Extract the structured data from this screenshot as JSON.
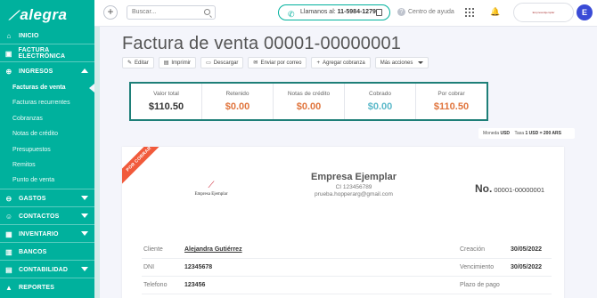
{
  "app": {
    "logo_text": "alegra"
  },
  "sidebar": {
    "items": [
      {
        "label": "INICIO",
        "icon": "home-icon"
      },
      {
        "label": "FACTURA ELECTRÓNICA",
        "icon": "invoice-icon"
      },
      {
        "label": "INGRESOS",
        "icon": "income-icon"
      },
      {
        "label": "GASTOS",
        "icon": "expenses-icon"
      },
      {
        "label": "CONTACTOS",
        "icon": "contacts-icon"
      },
      {
        "label": "INVENTARIO",
        "icon": "inventory-icon"
      },
      {
        "label": "BANCOS",
        "icon": "bank-icon"
      },
      {
        "label": "CONTABILIDAD",
        "icon": "accounting-icon"
      },
      {
        "label": "REPORTES",
        "icon": "reports-icon"
      }
    ],
    "income_sub": [
      "Facturas de venta",
      "Facturas recurrentes",
      "Cobranzas",
      "Notas de crédito",
      "Presupuestos",
      "Remitos",
      "Punto de venta"
    ],
    "active_sub": "Facturas de venta"
  },
  "topbar": {
    "search_placeholder": "Buscar...",
    "call_prefix": "Llamanos al:",
    "call_number": "11-5984-1279",
    "help_label": "Centro de ayuda",
    "avatar_initial": "E",
    "company_logo_text": "Empresa Ejemplar"
  },
  "page": {
    "title": "Factura de venta 00001-00000001",
    "actions": {
      "edit": "Editar",
      "print": "Imprimir",
      "download": "Descargar",
      "email": "Enviar por correo",
      "add_payment": "Agregar cobranza",
      "more": "Más acciones"
    }
  },
  "summary": [
    {
      "label": "Valor total",
      "value": "$110.50",
      "color": "#333333"
    },
    {
      "label": "Retenido",
      "value": "$0.00",
      "color": "#e0743c"
    },
    {
      "label": "Notas de crédito",
      "value": "$0.00",
      "color": "#e0743c"
    },
    {
      "label": "Cobrado",
      "value": "$0.00",
      "color": "#5ab8c9"
    },
    {
      "label": "Por cobrar",
      "value": "$110.50",
      "color": "#e0743c"
    }
  ],
  "currency": {
    "currency_label": "Moneda",
    "currency_value": "USD",
    "rate_label": "Tasa",
    "rate_value": "1 USD = 200 ARS"
  },
  "document": {
    "ribbon": "POR COBRAR",
    "logo_name": "Empresa Ejemplar",
    "company_name": "Empresa Ejemplar",
    "company_ci": "CI 123456789",
    "company_email": "prueba.hopperarg@gmail.com",
    "number_label": "No.",
    "number_value": "00001-00000001",
    "rows": [
      {
        "k1": "Cliente",
        "v1": "Alejandra Gutiérrez",
        "k2": "Creación",
        "v2": "30/05/2022"
      },
      {
        "k1": "DNI",
        "v1": "12345678",
        "k2": "Vencimiento",
        "v2": "30/05/2022"
      },
      {
        "k1": "Telefono",
        "v1": "123456",
        "k2": "Plazo de pago",
        "v2": ""
      }
    ]
  },
  "colors": {
    "brand": "#00b19d",
    "accent_blue": "#3a4bd6",
    "ribbon": "#f15a3b"
  }
}
